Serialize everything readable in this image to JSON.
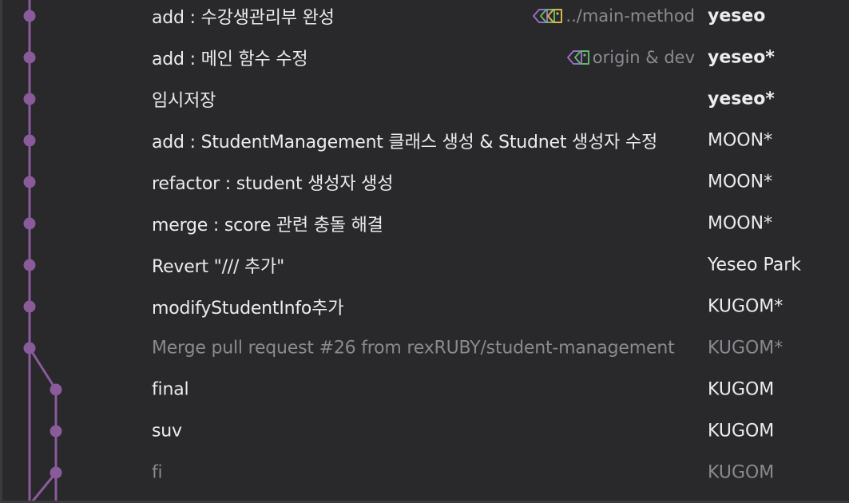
{
  "colors": {
    "background": "#29282b",
    "graph_line": "#8a5b9b",
    "text": "#ecebef",
    "dim_text": "#8a898e",
    "tag_purple": "#9a6cc8",
    "tag_green": "#5fb86d",
    "tag_yellow": "#d9b84a"
  },
  "commits": [
    {
      "message": "add : 수강생관리부 완성",
      "author": "yeseo",
      "author_bold": true,
      "ref": "../main-method",
      "ref_icon": "triple-tag-icon",
      "dim": false
    },
    {
      "message": "add : 메인 함수 수정",
      "author": "yeseo*",
      "author_bold": true,
      "ref": "origin & dev",
      "ref_icon": "double-tag-icon",
      "dim": false
    },
    {
      "message": "임시저장",
      "author": "yeseo*",
      "author_bold": true,
      "dim": false
    },
    {
      "message": "add : StudentManagement 클래스 생성 & Studnet 생성자 수정",
      "author": "MOON*",
      "dim": false
    },
    {
      "message": "refactor : student 생성자 생성",
      "author": "MOON*",
      "dim": false
    },
    {
      "message": "merge : score 관련 충돌 해결",
      "author": "MOON*",
      "dim": false
    },
    {
      "message": "Revert \"/// 추가\"",
      "author": "Yeseo Park",
      "dim": false
    },
    {
      "message": "modifyStudentInfo추가",
      "author": "KUGOM*",
      "dim": false
    },
    {
      "message": "Merge pull request #26 from rexRUBY/student-management",
      "author": "KUGOM*",
      "dim": true
    },
    {
      "message": "final",
      "author": "KUGOM",
      "dim": false
    },
    {
      "message": "suv",
      "author": "KUGOM",
      "dim": false
    },
    {
      "message": "fi",
      "author": "KUGOM",
      "dim": true
    }
  ]
}
